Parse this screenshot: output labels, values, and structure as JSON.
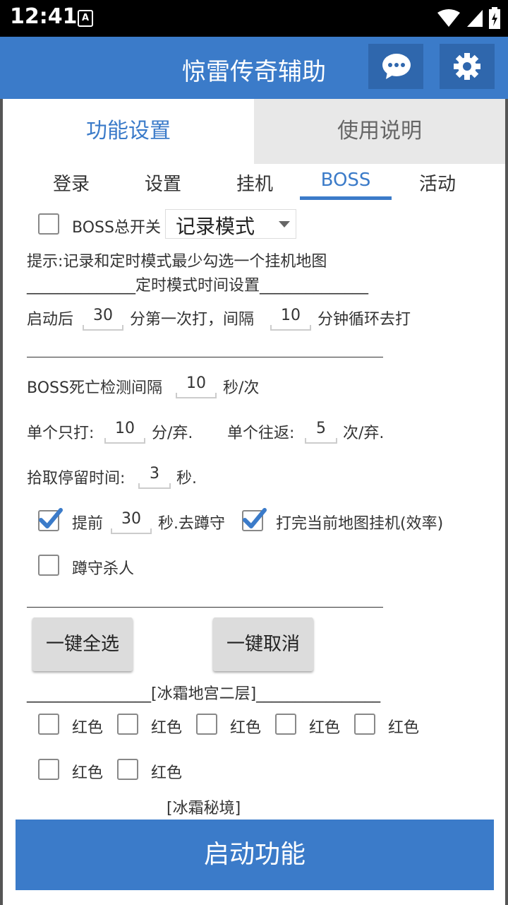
{
  "status": {
    "time": "12:41",
    "badge": "A"
  },
  "appbar": {
    "title": "惊雷传奇辅助"
  },
  "tabs": [
    {
      "label": "功能设置"
    },
    {
      "label": "使用说明"
    }
  ],
  "subtabs": [
    {
      "label": "登录"
    },
    {
      "label": "设置"
    },
    {
      "label": "挂机"
    },
    {
      "label": "BOSS"
    },
    {
      "label": "活动"
    }
  ],
  "boss": {
    "master_switch_label": "BOSS总开关",
    "mode_value": "记录模式",
    "hint": "提示:记录和定时模式最少勾选一个挂机地图",
    "timer_heading": "______________定时模式时间设置______________",
    "start_prefix": "启动后",
    "first_minutes": "30",
    "first_suffix": "分第一次打，间隔",
    "interval_minutes": "10",
    "interval_suffix": "分钟循环去打",
    "death_check_label": "BOSS死亡检测间隔",
    "death_check_value": "10",
    "death_check_unit": "秒/次",
    "single_hit_label": "单个只打:",
    "single_hit_value": "10",
    "single_hit_unit": "分/弃.",
    "round_trip_label": "单个往返:",
    "round_trip_value": "5",
    "round_trip_unit": "次/弃.",
    "pickup_label": "拾取停留时间:",
    "pickup_value": "3",
    "pickup_unit": "秒.",
    "advance_label": "提前",
    "advance_value": "30",
    "advance_unit": "秒.去蹲守",
    "finish_map_label": "打完当前地图挂机(效率)",
    "camp_kill_label": "蹲守杀人",
    "select_all": "一键全选",
    "cancel_all": "一键取消",
    "map1_heading": "________________[冰霜地宫二层]________________",
    "map1_items": [
      "红色",
      "红色",
      "红色",
      "红色",
      "红色",
      "红色",
      "红色"
    ],
    "map2_heading": "[冰霜秘境]"
  },
  "start_button": "启动功能",
  "colors": {
    "accent": "#3b7bc9",
    "accent_dark": "#2f67ad"
  }
}
